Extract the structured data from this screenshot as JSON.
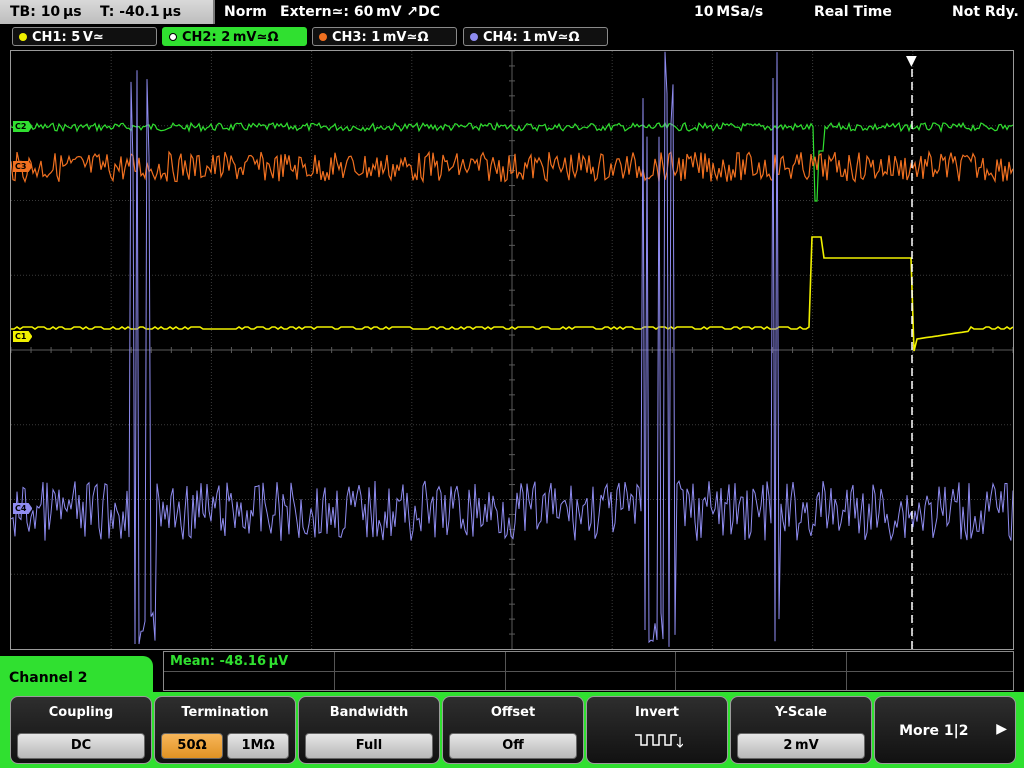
{
  "status_bar": {
    "timebase": "TB: 10 µs",
    "trigger_time": "T: -40.1 µs",
    "mode": "Norm",
    "trigger_source": "Extern≃: 60 mV ↗DC",
    "sample_rate": "10 MSa/s",
    "acq_mode": "Real Time",
    "state": "Not Rdy."
  },
  "channels": [
    {
      "label": "CH1: 5 V≃",
      "color": "#f0f000",
      "marker": "C1"
    },
    {
      "label": "CH2: 2 mV≃Ω",
      "color": "#30e030",
      "marker": "C2",
      "active": true
    },
    {
      "label": "CH3: 1 mV≃Ω",
      "color": "#f07020",
      "marker": "C3"
    },
    {
      "label": "CH4: 1 mV≃Ω",
      "color": "#8f8cf0",
      "marker": "C4"
    }
  ],
  "measurement": {
    "mean": "Mean: -48.16 µV"
  },
  "menu": {
    "title": "Channel 2"
  },
  "softkeys": {
    "coupling": {
      "title": "Coupling",
      "value": "DC"
    },
    "termination": {
      "title": "Termination",
      "option_a": "50Ω",
      "option_b": "1MΩ"
    },
    "bandwidth": {
      "title": "Bandwidth",
      "value": "Full"
    },
    "offset": {
      "title": "Offset",
      "value": "Off"
    },
    "invert": {
      "title": "Invert"
    },
    "yscale": {
      "title": "Y-Scale",
      "value": "2 mV"
    },
    "more": {
      "title": "More 1|2"
    }
  },
  "colors": {
    "grid": "#3a3a3a",
    "active_channel": "#30e030",
    "trigger_line": "#ffffff"
  }
}
